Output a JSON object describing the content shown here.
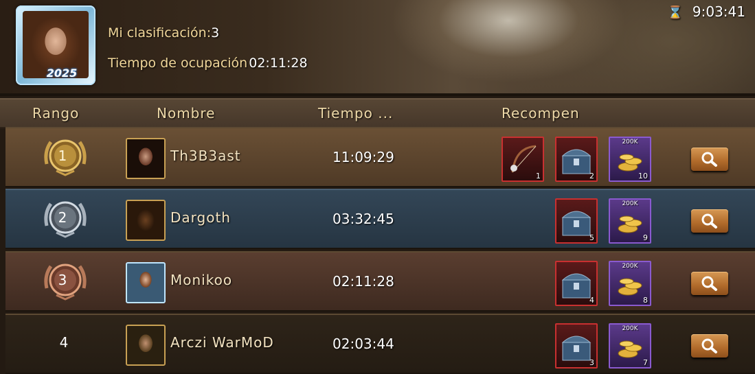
{
  "header": {
    "my_rank_label": "Mi clasificación:",
    "my_rank_value": "3",
    "occupation_label": "Tiempo de ocupación",
    "occupation_value": "02:11:28",
    "clock": "9:03:41",
    "avatar_badge": "2025"
  },
  "columns": {
    "rank": "Rango",
    "name": "Nombre",
    "time": "Tiempo ...",
    "rewards": "Recompen"
  },
  "rows": [
    {
      "rank": "1",
      "name": "Th3B3ast",
      "time": "11:09:29",
      "medal": "gold",
      "rewards": [
        {
          "icon": "bow-icon",
          "count": "1",
          "frame": "red"
        },
        {
          "icon": "chest-icon",
          "count": "2",
          "frame": "red"
        },
        {
          "icon": "gold-coins-icon",
          "count": "10",
          "label": "200K",
          "frame": "purple"
        }
      ]
    },
    {
      "rank": "2",
      "name": "Dargoth",
      "time": "03:32:45",
      "medal": "silver",
      "rewards": [
        {
          "icon": "chest-icon",
          "count": "5",
          "frame": "red"
        },
        {
          "icon": "gold-coins-icon",
          "count": "9",
          "label": "200K",
          "frame": "purple"
        }
      ]
    },
    {
      "rank": "3",
      "name": "Monikoo",
      "time": "02:11:28",
      "medal": "bronze",
      "rewards": [
        {
          "icon": "chest-icon",
          "count": "4",
          "frame": "red"
        },
        {
          "icon": "gold-coins-icon",
          "count": "8",
          "label": "200K",
          "frame": "purple"
        }
      ]
    },
    {
      "rank": "4",
      "name": "Arczi WarMoD",
      "time": "02:03:44",
      "medal": "none",
      "rewards": [
        {
          "icon": "chest-icon",
          "count": "3",
          "frame": "red"
        },
        {
          "icon": "gold-coins-icon",
          "count": "7",
          "label": "200K",
          "frame": "purple"
        }
      ]
    }
  ],
  "colors": {
    "gold": "#d8b25a",
    "silver": "#b8c3cf",
    "bronze": "#b87a5a",
    "accent": "#f1d79a"
  }
}
